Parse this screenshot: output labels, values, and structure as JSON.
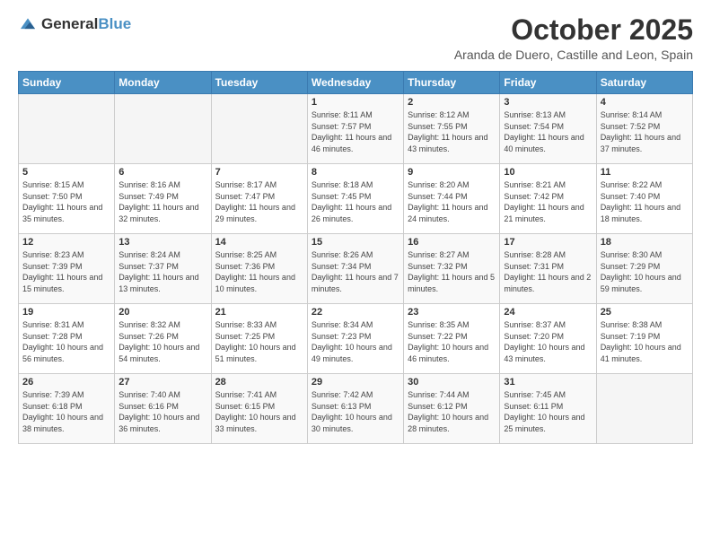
{
  "header": {
    "logo_general": "General",
    "logo_blue": "Blue",
    "month": "October 2025",
    "location": "Aranda de Duero, Castille and Leon, Spain"
  },
  "days_of_week": [
    "Sunday",
    "Monday",
    "Tuesday",
    "Wednesday",
    "Thursday",
    "Friday",
    "Saturday"
  ],
  "weeks": [
    [
      {
        "day": "",
        "sunrise": "",
        "sunset": "",
        "daylight": ""
      },
      {
        "day": "",
        "sunrise": "",
        "sunset": "",
        "daylight": ""
      },
      {
        "day": "",
        "sunrise": "",
        "sunset": "",
        "daylight": ""
      },
      {
        "day": "1",
        "sunrise": "Sunrise: 8:11 AM",
        "sunset": "Sunset: 7:57 PM",
        "daylight": "Daylight: 11 hours and 46 minutes."
      },
      {
        "day": "2",
        "sunrise": "Sunrise: 8:12 AM",
        "sunset": "Sunset: 7:55 PM",
        "daylight": "Daylight: 11 hours and 43 minutes."
      },
      {
        "day": "3",
        "sunrise": "Sunrise: 8:13 AM",
        "sunset": "Sunset: 7:54 PM",
        "daylight": "Daylight: 11 hours and 40 minutes."
      },
      {
        "day": "4",
        "sunrise": "Sunrise: 8:14 AM",
        "sunset": "Sunset: 7:52 PM",
        "daylight": "Daylight: 11 hours and 37 minutes."
      }
    ],
    [
      {
        "day": "5",
        "sunrise": "Sunrise: 8:15 AM",
        "sunset": "Sunset: 7:50 PM",
        "daylight": "Daylight: 11 hours and 35 minutes."
      },
      {
        "day": "6",
        "sunrise": "Sunrise: 8:16 AM",
        "sunset": "Sunset: 7:49 PM",
        "daylight": "Daylight: 11 hours and 32 minutes."
      },
      {
        "day": "7",
        "sunrise": "Sunrise: 8:17 AM",
        "sunset": "Sunset: 7:47 PM",
        "daylight": "Daylight: 11 hours and 29 minutes."
      },
      {
        "day": "8",
        "sunrise": "Sunrise: 8:18 AM",
        "sunset": "Sunset: 7:45 PM",
        "daylight": "Daylight: 11 hours and 26 minutes."
      },
      {
        "day": "9",
        "sunrise": "Sunrise: 8:20 AM",
        "sunset": "Sunset: 7:44 PM",
        "daylight": "Daylight: 11 hours and 24 minutes."
      },
      {
        "day": "10",
        "sunrise": "Sunrise: 8:21 AM",
        "sunset": "Sunset: 7:42 PM",
        "daylight": "Daylight: 11 hours and 21 minutes."
      },
      {
        "day": "11",
        "sunrise": "Sunrise: 8:22 AM",
        "sunset": "Sunset: 7:40 PM",
        "daylight": "Daylight: 11 hours and 18 minutes."
      }
    ],
    [
      {
        "day": "12",
        "sunrise": "Sunrise: 8:23 AM",
        "sunset": "Sunset: 7:39 PM",
        "daylight": "Daylight: 11 hours and 15 minutes."
      },
      {
        "day": "13",
        "sunrise": "Sunrise: 8:24 AM",
        "sunset": "Sunset: 7:37 PM",
        "daylight": "Daylight: 11 hours and 13 minutes."
      },
      {
        "day": "14",
        "sunrise": "Sunrise: 8:25 AM",
        "sunset": "Sunset: 7:36 PM",
        "daylight": "Daylight: 11 hours and 10 minutes."
      },
      {
        "day": "15",
        "sunrise": "Sunrise: 8:26 AM",
        "sunset": "Sunset: 7:34 PM",
        "daylight": "Daylight: 11 hours and 7 minutes."
      },
      {
        "day": "16",
        "sunrise": "Sunrise: 8:27 AM",
        "sunset": "Sunset: 7:32 PM",
        "daylight": "Daylight: 11 hours and 5 minutes."
      },
      {
        "day": "17",
        "sunrise": "Sunrise: 8:28 AM",
        "sunset": "Sunset: 7:31 PM",
        "daylight": "Daylight: 11 hours and 2 minutes."
      },
      {
        "day": "18",
        "sunrise": "Sunrise: 8:30 AM",
        "sunset": "Sunset: 7:29 PM",
        "daylight": "Daylight: 10 hours and 59 minutes."
      }
    ],
    [
      {
        "day": "19",
        "sunrise": "Sunrise: 8:31 AM",
        "sunset": "Sunset: 7:28 PM",
        "daylight": "Daylight: 10 hours and 56 minutes."
      },
      {
        "day": "20",
        "sunrise": "Sunrise: 8:32 AM",
        "sunset": "Sunset: 7:26 PM",
        "daylight": "Daylight: 10 hours and 54 minutes."
      },
      {
        "day": "21",
        "sunrise": "Sunrise: 8:33 AM",
        "sunset": "Sunset: 7:25 PM",
        "daylight": "Daylight: 10 hours and 51 minutes."
      },
      {
        "day": "22",
        "sunrise": "Sunrise: 8:34 AM",
        "sunset": "Sunset: 7:23 PM",
        "daylight": "Daylight: 10 hours and 49 minutes."
      },
      {
        "day": "23",
        "sunrise": "Sunrise: 8:35 AM",
        "sunset": "Sunset: 7:22 PM",
        "daylight": "Daylight: 10 hours and 46 minutes."
      },
      {
        "day": "24",
        "sunrise": "Sunrise: 8:37 AM",
        "sunset": "Sunset: 7:20 PM",
        "daylight": "Daylight: 10 hours and 43 minutes."
      },
      {
        "day": "25",
        "sunrise": "Sunrise: 8:38 AM",
        "sunset": "Sunset: 7:19 PM",
        "daylight": "Daylight: 10 hours and 41 minutes."
      }
    ],
    [
      {
        "day": "26",
        "sunrise": "Sunrise: 7:39 AM",
        "sunset": "Sunset: 6:18 PM",
        "daylight": "Daylight: 10 hours and 38 minutes."
      },
      {
        "day": "27",
        "sunrise": "Sunrise: 7:40 AM",
        "sunset": "Sunset: 6:16 PM",
        "daylight": "Daylight: 10 hours and 36 minutes."
      },
      {
        "day": "28",
        "sunrise": "Sunrise: 7:41 AM",
        "sunset": "Sunset: 6:15 PM",
        "daylight": "Daylight: 10 hours and 33 minutes."
      },
      {
        "day": "29",
        "sunrise": "Sunrise: 7:42 AM",
        "sunset": "Sunset: 6:13 PM",
        "daylight": "Daylight: 10 hours and 30 minutes."
      },
      {
        "day": "30",
        "sunrise": "Sunrise: 7:44 AM",
        "sunset": "Sunset: 6:12 PM",
        "daylight": "Daylight: 10 hours and 28 minutes."
      },
      {
        "day": "31",
        "sunrise": "Sunrise: 7:45 AM",
        "sunset": "Sunset: 6:11 PM",
        "daylight": "Daylight: 10 hours and 25 minutes."
      },
      {
        "day": "",
        "sunrise": "",
        "sunset": "",
        "daylight": ""
      }
    ]
  ]
}
